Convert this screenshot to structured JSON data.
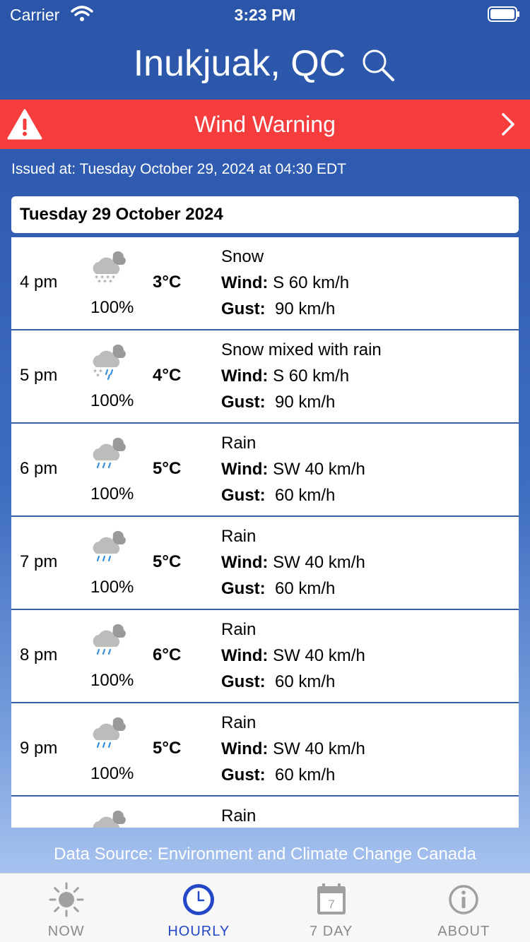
{
  "status_bar": {
    "carrier": "Carrier",
    "time": "3:23 PM"
  },
  "header": {
    "city": "Inukjuak, QC"
  },
  "warning": {
    "label": "Wind Warning",
    "issued": "Issued at: Tuesday October 29, 2024 at 04:30 EDT"
  },
  "forecast": {
    "date": "Tuesday 29 October 2024",
    "wind_label": "Wind:",
    "gust_label": "Gust:",
    "hours": [
      {
        "time": "4 pm",
        "icon": "snow-cloud-icon",
        "pop": "100%",
        "temp": "3°C",
        "condition": "Snow",
        "wind": "S 60 km/h",
        "gust": "90 km/h"
      },
      {
        "time": "5 pm",
        "icon": "snow-rain-cloud-icon",
        "pop": "100%",
        "temp": "4°C",
        "condition": "Snow mixed with rain",
        "wind": "S 60 km/h",
        "gust": "90 km/h"
      },
      {
        "time": "6 pm",
        "icon": "rain-cloud-icon",
        "pop": "100%",
        "temp": "5°C",
        "condition": "Rain",
        "wind": "SW 40 km/h",
        "gust": "60 km/h"
      },
      {
        "time": "7 pm",
        "icon": "rain-cloud-icon",
        "pop": "100%",
        "temp": "5°C",
        "condition": "Rain",
        "wind": "SW 40 km/h",
        "gust": "60 km/h"
      },
      {
        "time": "8 pm",
        "icon": "rain-cloud-icon",
        "pop": "100%",
        "temp": "6°C",
        "condition": "Rain",
        "wind": "SW 40 km/h",
        "gust": "60 km/h"
      },
      {
        "time": "9 pm",
        "icon": "rain-cloud-icon",
        "pop": "100%",
        "temp": "5°C",
        "condition": "Rain",
        "wind": "SW 40 km/h",
        "gust": "60 km/h"
      },
      {
        "time": "",
        "icon": "rain-cloud-icon",
        "pop": "",
        "temp": "",
        "condition": "Rain",
        "wind": "",
        "gust": ""
      }
    ]
  },
  "footer": {
    "data_source": "Data Source: Environment and Climate Change Canada"
  },
  "tabs": [
    {
      "label": "NOW",
      "icon": "sun-icon"
    },
    {
      "label": "HOURLY",
      "icon": "clock-icon"
    },
    {
      "label": "7 DAY",
      "icon": "calendar-icon",
      "icon_text": "7"
    },
    {
      "label": "ABOUT",
      "icon": "info-icon"
    }
  ],
  "colors": {
    "warning_red": "#f53d3d",
    "header_blue": "#2a55a8",
    "active_tab": "#2447c7",
    "inactive_tab": "#8a8a8a"
  }
}
